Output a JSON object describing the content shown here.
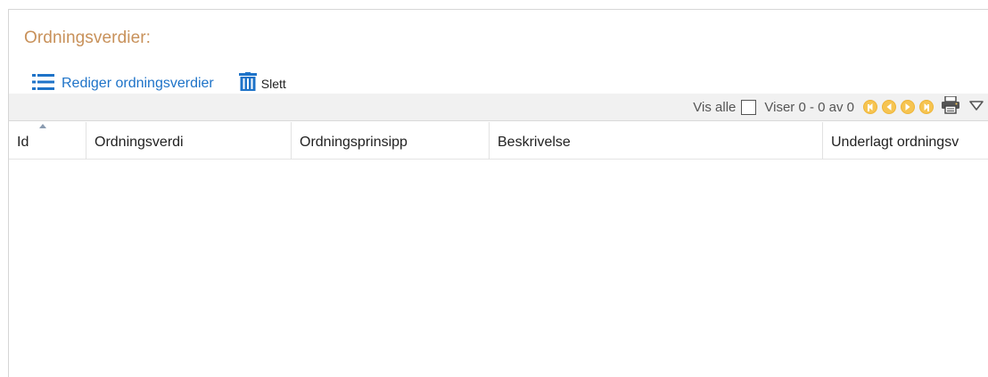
{
  "panel": {
    "title": "Ordningsverdier:"
  },
  "toolbar": {
    "edit_label": "Rediger ordningsverdier",
    "delete_label": "Slett"
  },
  "pager": {
    "show_all_label": "Vis alle",
    "show_all_checked": false,
    "range_text": "Viser 0 - 0 av 0"
  },
  "grid": {
    "columns": [
      {
        "label": "Id",
        "sorted": "asc"
      },
      {
        "label": "Ordningsverdi"
      },
      {
        "label": "Ordningsprinsipp"
      },
      {
        "label": "Beskrivelse"
      },
      {
        "label": "Underlagt ordningsv"
      }
    ],
    "rows": []
  },
  "colors": {
    "title": "#c8915a",
    "link": "#1e73c8",
    "nav_button": "#f6c451",
    "toolbar_bg": "#f1f1f1"
  },
  "icons": {
    "edit": "list-icon",
    "delete": "trash-icon",
    "print": "printer-icon",
    "menu": "triangle-down-icon"
  }
}
